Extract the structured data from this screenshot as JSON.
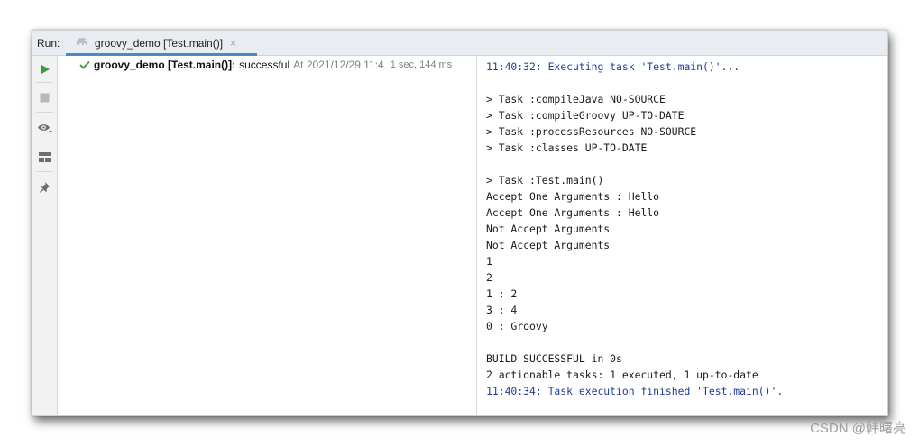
{
  "header": {
    "run_label": "Run:",
    "tab_label": "groovy_demo [Test.main()]",
    "tab_close": "×"
  },
  "toolbar": {
    "buttons": [
      "run-icon",
      "stop-icon",
      "eye-icon",
      "layout-icon",
      "pin-icon"
    ],
    "run_color": "#3d9b42"
  },
  "tree": {
    "name": "groovy_demo [Test.main()]:",
    "status": "successful",
    "timestamp": "At 2021/12/29 11:4",
    "duration": "1 sec, 144 ms"
  },
  "console": {
    "lines": [
      {
        "text": "11:40:32: Executing task 'Test.main()'...",
        "kind": "info"
      },
      {
        "text": "",
        "kind": "plain"
      },
      {
        "text": "> Task :compileJava NO-SOURCE",
        "kind": "plain"
      },
      {
        "text": "> Task :compileGroovy UP-TO-DATE",
        "kind": "plain"
      },
      {
        "text": "> Task :processResources NO-SOURCE",
        "kind": "plain"
      },
      {
        "text": "> Task :classes UP-TO-DATE",
        "kind": "plain"
      },
      {
        "text": "",
        "kind": "plain"
      },
      {
        "text": "> Task :Test.main()",
        "kind": "plain"
      },
      {
        "text": "Accept One Arguments : Hello",
        "kind": "plain"
      },
      {
        "text": "Accept One Arguments : Hello",
        "kind": "plain"
      },
      {
        "text": "Not Accept Arguments",
        "kind": "plain"
      },
      {
        "text": "Not Accept Arguments",
        "kind": "plain"
      },
      {
        "text": "1",
        "kind": "plain"
      },
      {
        "text": "2",
        "kind": "plain"
      },
      {
        "text": "1 : 2",
        "kind": "plain"
      },
      {
        "text": "3 : 4",
        "kind": "plain"
      },
      {
        "text": "0 : Groovy",
        "kind": "plain"
      },
      {
        "text": "",
        "kind": "plain"
      },
      {
        "text": "BUILD SUCCESSFUL in 0s",
        "kind": "plain"
      },
      {
        "text": "2 actionable tasks: 1 executed, 1 up-to-date",
        "kind": "plain"
      },
      {
        "text": "11:40:34: Task execution finished 'Test.main()'.",
        "kind": "info"
      }
    ]
  },
  "watermark": "CSDN @韩曙亮"
}
